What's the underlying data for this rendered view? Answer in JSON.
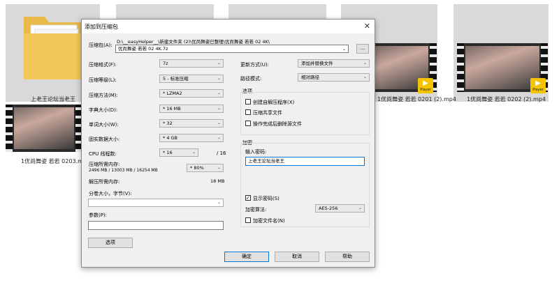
{
  "explorer": {
    "folder_label": "上老王论坛当老王",
    "files": [
      {
        "name": "1优尚舞姿 若若 0203.mp4"
      },
      {
        "name": "1优尚舞姿 若若 0201 (2).mp4"
      },
      {
        "name": "1优尚舞姿 若若 0202 (2).mp4"
      }
    ],
    "player_badge": "Player"
  },
  "dialog": {
    "title": "添加到压缩包",
    "close_glyph": "✕",
    "archive": {
      "label": "压缩包(A):",
      "path": "D:\\__easyHelper__\\新建文件夹 (2)\\优尚舞姿已整理\\优尚舞姿 若若 02 4K\\",
      "value": "优尚舞姿 若若 02 4K.7z",
      "browse_label": "..."
    },
    "left": {
      "format": {
        "label": "压缩格式(F):",
        "value": "7z"
      },
      "level": {
        "label": "压缩等级(L):",
        "value": "5 - 标准压缩"
      },
      "method": {
        "label": "压缩方法(M):",
        "value": "* LZMA2"
      },
      "dict": {
        "label": "字典大小(D):",
        "value": "* 16 MB"
      },
      "word": {
        "label": "单词大小(W):",
        "value": "* 32"
      },
      "solid": {
        "label": "固实数据大小:",
        "value": "* 4 GB"
      },
      "threads": {
        "label": "CPU 线程数:",
        "value": "* 16",
        "max": "/ 16"
      },
      "mem_compress": {
        "label": "压缩所需内存:",
        "detail": "2496 MB / 13003 MB / 16254 MB",
        "value": "* 80%"
      },
      "mem_decompress": {
        "label": "解压所需内存:",
        "value": "18 MB"
      },
      "volume": {
        "label": "分卷大小，字节(V):",
        "value": ""
      },
      "params": {
        "label": "参数(P):",
        "value": ""
      },
      "options_button": "选项"
    },
    "right": {
      "update": {
        "label": "更新方式(U):",
        "value": "添加并替换文件"
      },
      "pathmode": {
        "label": "路径模式:",
        "value": "相对路径"
      },
      "options_title": "选项",
      "opt_sfx": "创建自解压程序(X)",
      "opt_shared": "压缩共享文件",
      "opt_delete": "操作完成后删除源文件",
      "encrypt_title": "加密",
      "password_label": "输入密码:",
      "password_value": "上老王论坛当老王",
      "show_password": "显示密码(S)",
      "show_password_check": "✓",
      "algo": {
        "label": "加密算法:",
        "value": "AES-256"
      },
      "encrypt_names": "加密文件名(N)"
    },
    "buttons": {
      "ok": "确定",
      "cancel": "取消",
      "help": "帮助"
    },
    "arrow_glyph": "⌄"
  }
}
